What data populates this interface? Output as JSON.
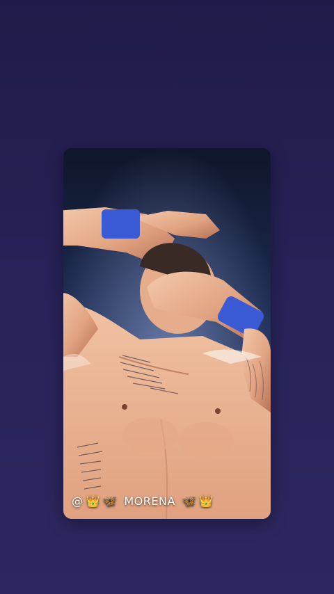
{
  "story": {
    "caption": {
      "prefix": "@",
      "emoji_crown": "👑",
      "emoji_butterfly": "🦋",
      "name": "MORENA"
    }
  }
}
